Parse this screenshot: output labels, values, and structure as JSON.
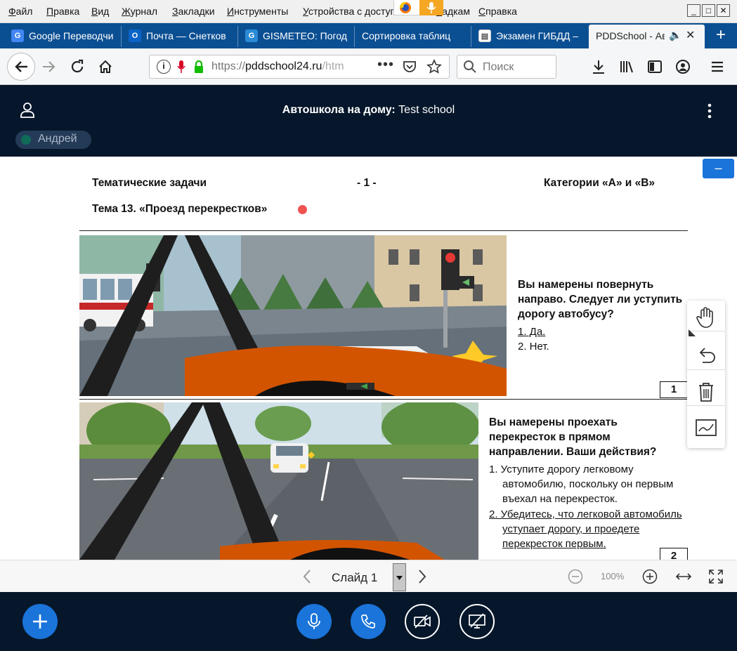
{
  "menu": [
    "Файл",
    "Правка",
    "Вид",
    "Журнал",
    "Закладки",
    "Инструменты",
    "Устройства с доступом к",
    "ладкам",
    "Справка"
  ],
  "tabs": [
    {
      "label": "Google Переводчи",
      "icon": "google-translate-icon"
    },
    {
      "label": "Почта — Снетков",
      "icon": "outlook-icon"
    },
    {
      "label": "GISMETEO: Погод",
      "icon": "gismeteo-icon"
    },
    {
      "label": "Сортировка таблиц",
      "icon": ""
    },
    {
      "label": "Экзамен ГИБДД –",
      "icon": "document-icon"
    },
    {
      "label": "PDDSchool - Ав",
      "icon": "audio-icon"
    }
  ],
  "nav": {
    "url_prefix": "https://",
    "url_host": "pddschool24.ru",
    "url_rest": "/htm",
    "search_placeholder": "Поиск"
  },
  "app": {
    "title_bold": "Автошкола на дому:",
    "title_rest": " Test school",
    "user": "Андрей"
  },
  "slide": {
    "left_header": "Тематические задачи",
    "page_marker": "- 1 -",
    "right_header": "Категории «А» и «В»",
    "topic": "Тема 13. «Проезд перекрестков»",
    "questions": [
      {
        "number": "1",
        "text": "Вы намерены повернуть направо. Следует ли уступить дорогу автобусу?",
        "answers": [
          "1. Да.",
          "2. Нет."
        ],
        "underlined": 0
      },
      {
        "number": "2",
        "text": "Вы намерены проехать перекресток в прямом направлении. Ваши действия?",
        "answers": [
          "1. Уступите дорогу легковому автомобилю, поскольку он первым въехал на перекресток.",
          "2. Убедитесь, что легковой автомобиль уступает дорогу, и проедете перекресток первым."
        ],
        "underlined": 1
      }
    ]
  },
  "collapse_label": "–",
  "slidebar": {
    "label": "Слайд 1",
    "zoom": "100%"
  },
  "colors": {
    "dark": "#06172b",
    "blue": "#1b74d9",
    "tabbar": "#0b4f93",
    "red_dot": "#ef5350"
  }
}
